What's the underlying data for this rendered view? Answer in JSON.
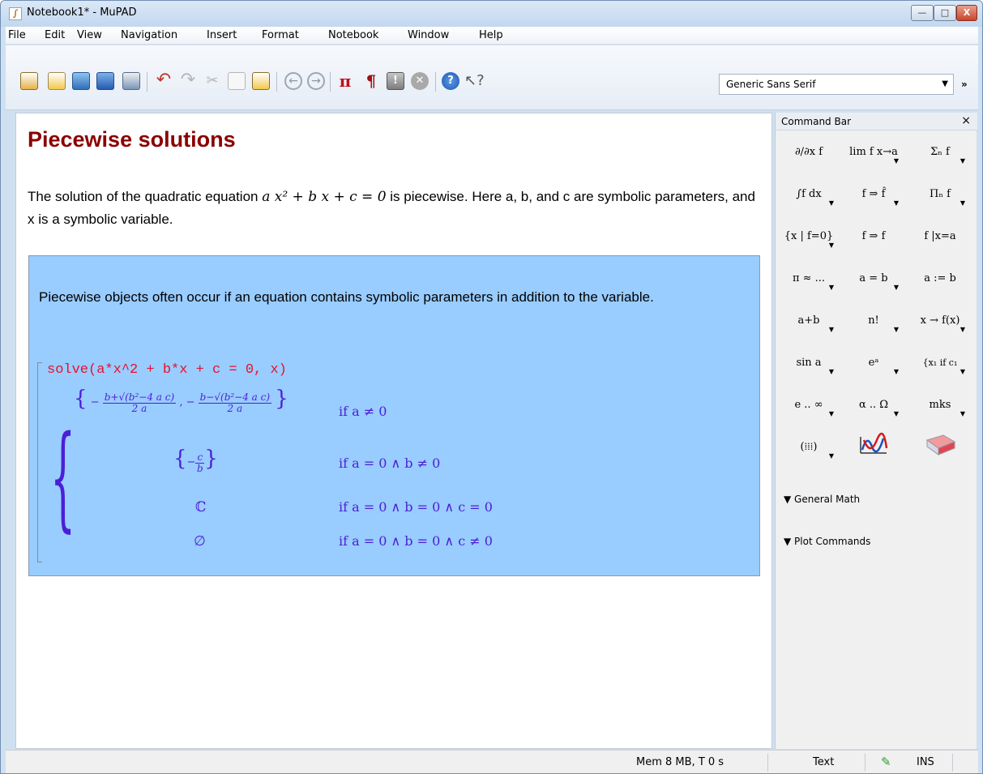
{
  "window": {
    "title": "Notebook1* - MuPAD",
    "controls": {
      "minimize": "—",
      "maximize": "□",
      "close": "X"
    }
  },
  "menu": [
    "File",
    "Edit",
    "View",
    "Navigation",
    "Insert",
    "Format",
    "Notebook",
    "Window",
    "Help"
  ],
  "toolbar": {
    "icons": [
      "new-notebook-icon",
      "new-document-icon",
      "open-icon",
      "save-icon",
      "print-icon",
      "undo-icon",
      "redo-icon",
      "cut-icon",
      "copy-icon",
      "paste-icon",
      "back-icon",
      "forward-icon",
      "evaluate-pi-icon",
      "paragraph-icon",
      "stop-icon",
      "cancel-icon",
      "help-icon",
      "context-help-icon"
    ],
    "font": "Generic Sans Serif",
    "more": "»"
  },
  "document": {
    "title": "Piecewise solutions",
    "intro_a": "The solution of the quadratic equation ",
    "intro_eq": "a x² + b x + c = 0",
    "intro_b": " is piecewise. Here a, b, and c are symbolic parameters, and x is a symbolic variable.",
    "group_text": "Piecewise objects often occur if an equation contains symbolic parameters in addition to the variable.",
    "input": "solve(a*x^2 + b*x + c = 0, x)",
    "output": {
      "case1_num1": "b+√(b²−4 a c)",
      "case1_den1": "2 a",
      "case1_num2": "b−√(b²−4 a c)",
      "case1_den2": "2 a",
      "case2_num": "c",
      "case2_den": "b",
      "case3": "ℂ",
      "case4": "∅",
      "cond1": "if  a ≠ 0",
      "cond2": "if  a = 0 ∧ b ≠ 0",
      "cond3": "if  a = 0 ∧ b = 0 ∧ c = 0",
      "cond4": "if  a = 0 ∧ b = 0 ∧ c ≠ 0"
    }
  },
  "command_bar": {
    "title": "Command Bar",
    "close": "×",
    "commands": [
      "∂/∂x f",
      "lim f x→a",
      "Σₙ f",
      "∫f dx",
      "f ⇒ f̂",
      "Πₙ f",
      "{x | f=0}",
      "f ⇒ f",
      "f |x=a",
      "π ≈ ...",
      "a = b",
      "a := b",
      "a+b",
      "n!",
      "x → f(x)",
      "sin a",
      "eᵃ",
      "{x₁ if c₁",
      "e .. ∞",
      "α .. Ω",
      "mks"
    ],
    "graphics": [
      "matrix-icon",
      "plot-2d-icon",
      "plot-3d-icon"
    ],
    "sections": [
      "▼ General Math",
      "▼ Plot Commands"
    ]
  },
  "status": {
    "mem": "Mem 8 MB, T 0 s",
    "mode": "Text",
    "ins": "INS"
  }
}
